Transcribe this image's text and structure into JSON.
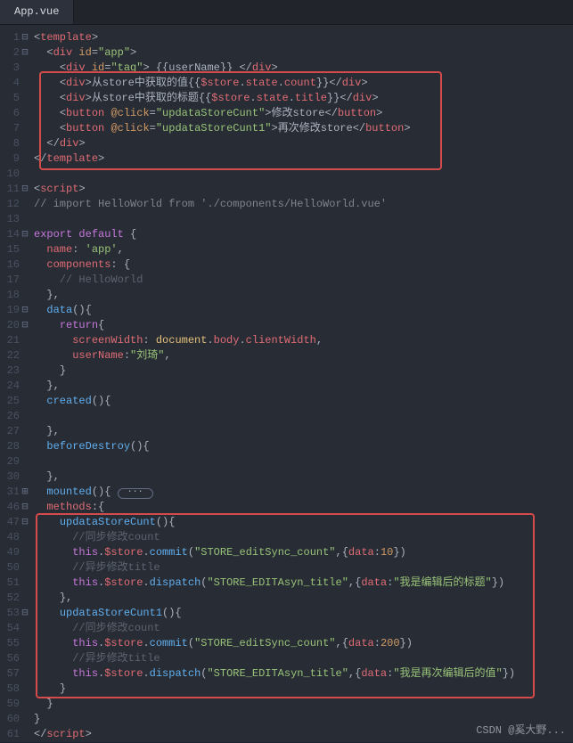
{
  "tab": {
    "title": "App.vue"
  },
  "lines": [
    {
      "n": "1",
      "f": "⊟"
    },
    {
      "n": "2",
      "f": "⊟"
    },
    {
      "n": "3",
      "f": ""
    },
    {
      "n": "4",
      "f": ""
    },
    {
      "n": "5",
      "f": ""
    },
    {
      "n": "6",
      "f": ""
    },
    {
      "n": "7",
      "f": ""
    },
    {
      "n": "8",
      "f": ""
    },
    {
      "n": "9",
      "f": ""
    },
    {
      "n": "10",
      "f": ""
    },
    {
      "n": "11",
      "f": "⊟"
    },
    {
      "n": "12",
      "f": ""
    },
    {
      "n": "13",
      "f": ""
    },
    {
      "n": "14",
      "f": "⊟"
    },
    {
      "n": "15",
      "f": ""
    },
    {
      "n": "16",
      "f": ""
    },
    {
      "n": "17",
      "f": ""
    },
    {
      "n": "18",
      "f": ""
    },
    {
      "n": "19",
      "f": "⊟"
    },
    {
      "n": "20",
      "f": "⊟"
    },
    {
      "n": "21",
      "f": ""
    },
    {
      "n": "22",
      "f": ""
    },
    {
      "n": "23",
      "f": ""
    },
    {
      "n": "24",
      "f": ""
    },
    {
      "n": "25",
      "f": ""
    },
    {
      "n": "26",
      "f": ""
    },
    {
      "n": "27",
      "f": ""
    },
    {
      "n": "28",
      "f": ""
    },
    {
      "n": "29",
      "f": ""
    },
    {
      "n": "30",
      "f": ""
    },
    {
      "n": "31",
      "f": "⊞"
    },
    {
      "n": "46",
      "f": "⊟"
    },
    {
      "n": "47",
      "f": "⊟"
    },
    {
      "n": "48",
      "f": ""
    },
    {
      "n": "49",
      "f": ""
    },
    {
      "n": "50",
      "f": ""
    },
    {
      "n": "51",
      "f": ""
    },
    {
      "n": "52",
      "f": ""
    },
    {
      "n": "53",
      "f": "⊟"
    },
    {
      "n": "54",
      "f": ""
    },
    {
      "n": "55",
      "f": ""
    },
    {
      "n": "56",
      "f": ""
    },
    {
      "n": "57",
      "f": ""
    },
    {
      "n": "58",
      "f": ""
    },
    {
      "n": "59",
      "f": ""
    },
    {
      "n": "60",
      "f": ""
    },
    {
      "n": "61",
      "f": ""
    }
  ],
  "code": {
    "t_template": "template",
    "t_div": "div",
    "t_button": "button",
    "t_script": "script",
    "a_id": "id",
    "a_click": "@click",
    "s_app": "\"app\"",
    "s_tag": "\"tag\"",
    "s_upd": "\"updataStoreCunt\"",
    "s_upd1": "\"updataStoreCunt1\"",
    "txt_username": " {{userName}} ",
    "txt_fromstore_val": "从store中获取的值{{",
    "txt_fromstore_title": "从store中获取的标题{{",
    "txt_mustache_close": "}}",
    "txt_modify": "修改store",
    "txt_modify2": "再次修改store",
    "cmt_import": "// import HelloWorld from './components/HelloWorld.vue'",
    "kw_export": "export",
    "kw_default": "default",
    "kw_return": "return",
    "kw_this": "this",
    "p_name": "name",
    "p_components": "components",
    "p_data": "data",
    "p_created": "created",
    "p_beforeDestroy": "beforeDestroy",
    "p_mounted": "mounted",
    "p_methods": "methods",
    "p_upd": "updataStoreCunt",
    "p_upd1": "updataStoreCunt1",
    "v_app": "'app'",
    "cmt_hello": "// HelloWorld",
    "p_screenWidth": "screenWidth",
    "v_document": "document",
    "v_body": "body",
    "v_clientWidth": "clientWidth",
    "p_userName": "userName",
    "v_liuqi": "\"刘琦\"",
    "v_store": "$store",
    "v_state": "state",
    "v_count": "count",
    "v_title": "title",
    "fn_commit": "commit",
    "fn_dispatch": "dispatch",
    "s_editSync": "\"STORE_editSync_count\"",
    "s_editAsyn": "\"STORE_EDITAsyn_title\"",
    "p_datakey": "data",
    "n_10": "10",
    "n_200": "200",
    "s_edited_title": "\"我是编辑后的标题\"",
    "s_edited_val": "\"我是再次编辑后的值\"",
    "cmt_sync": "//同步修改count",
    "cmt_asyn": "//异步修改title",
    "fold_dots": "···"
  },
  "watermark": "CSDN @奚大野..."
}
